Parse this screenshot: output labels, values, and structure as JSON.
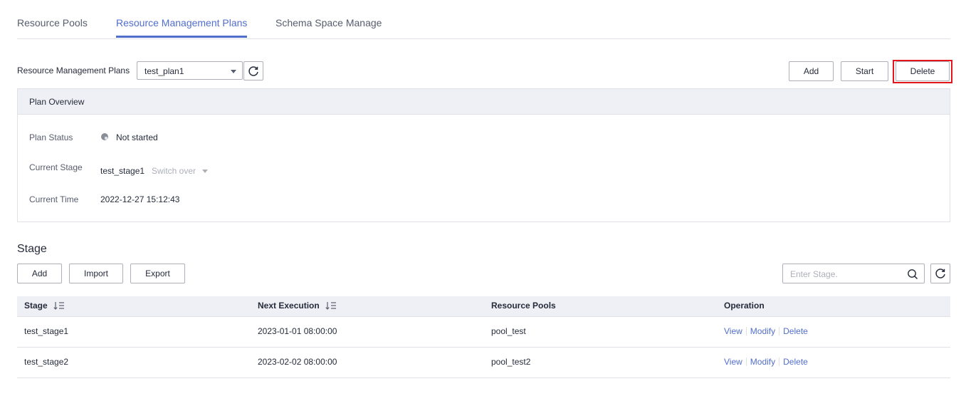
{
  "tabs": [
    {
      "label": "Resource Pools"
    },
    {
      "label": "Resource Management Plans"
    },
    {
      "label": "Schema Space Manage"
    }
  ],
  "active_tab": 1,
  "plan_bar": {
    "label": "Resource Management Plans",
    "selected_plan": "test_plan1",
    "refresh_icon": "refresh-icon",
    "dropdown_icon": "caret-down-icon"
  },
  "toolbar": {
    "add_label": "Add",
    "start_label": "Start",
    "delete_label": "Delete",
    "highlight_color": "#e3161c"
  },
  "overview": {
    "title": "Plan Overview",
    "status_label": "Plan Status",
    "status_value": "Not started",
    "stage_label": "Current Stage",
    "stage_value": "test_stage1",
    "switch_label": "Switch over",
    "time_label": "Current Time",
    "time_value": "2022-12-27 15:12:43"
  },
  "stage": {
    "title": "Stage",
    "add_label": "Add",
    "import_label": "Import",
    "export_label": "Export",
    "search_placeholder": "Enter Stage.",
    "search_icon": "search-icon"
  },
  "table": {
    "columns": [
      "Stage",
      "Next Execution",
      "Resource Pools",
      "Operation"
    ],
    "rows": [
      {
        "stage": "test_stage1",
        "next": "2023-01-01 08:00:00",
        "pool": "pool_test",
        "ops": [
          "View",
          "Modify",
          "Delete"
        ]
      },
      {
        "stage": "test_stage2",
        "next": "2023-02-02 08:00:00",
        "pool": "pool_test2",
        "ops": [
          "View",
          "Modify",
          "Delete"
        ]
      }
    ]
  },
  "colors": {
    "accent": "#526ecc",
    "header_bg": "#eef0f5",
    "border": "#dfe1e6"
  }
}
